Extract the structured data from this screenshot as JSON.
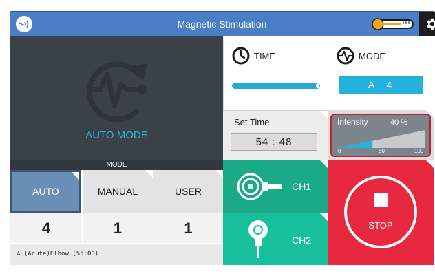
{
  "header": {
    "title": "Magnetic Stimulation",
    "logo_icon": "app-logo-icon",
    "temperature_icon": "thermometer-icon",
    "settings_icon": "gear-icon",
    "colors": {
      "bar": "#4a7fc8",
      "accent": "#f5a623"
    }
  },
  "main_panel": {
    "icon": "auto-mode-icon",
    "label": "AUTO MODE",
    "color": "#2bb4d6"
  },
  "mode_strip": {
    "label": "MODE"
  },
  "mode_tabs": [
    {
      "label": "AUTO",
      "count": "4",
      "selected": true
    },
    {
      "label": "MANUAL",
      "count": "1",
      "selected": false
    },
    {
      "label": "USER",
      "count": "1",
      "selected": false
    }
  ],
  "program": {
    "label": "4.(Acute)Elbow (55:00)"
  },
  "time": {
    "label": "TIME",
    "icon": "clock-icon",
    "progress": 0.97
  },
  "mode": {
    "label": "MODE",
    "icon": "waveform-icon",
    "value": "A 4"
  },
  "set_time": {
    "label": "Set Time",
    "value": "54 : 48"
  },
  "intensity": {
    "label": "Intensity",
    "value": "40 %",
    "level": 0.4,
    "scale": [
      "0",
      "50",
      "100"
    ],
    "color": "#c21d34"
  },
  "channels": [
    {
      "label": "CH1",
      "icon": "coil-probe-icon",
      "color": "#1aaa87"
    },
    {
      "label": "CH2",
      "icon": "handheld-probe-icon",
      "color": "#17c09b"
    }
  ],
  "stop": {
    "label": "STOP",
    "icon": "stop-icon",
    "color": "#e8283f"
  }
}
